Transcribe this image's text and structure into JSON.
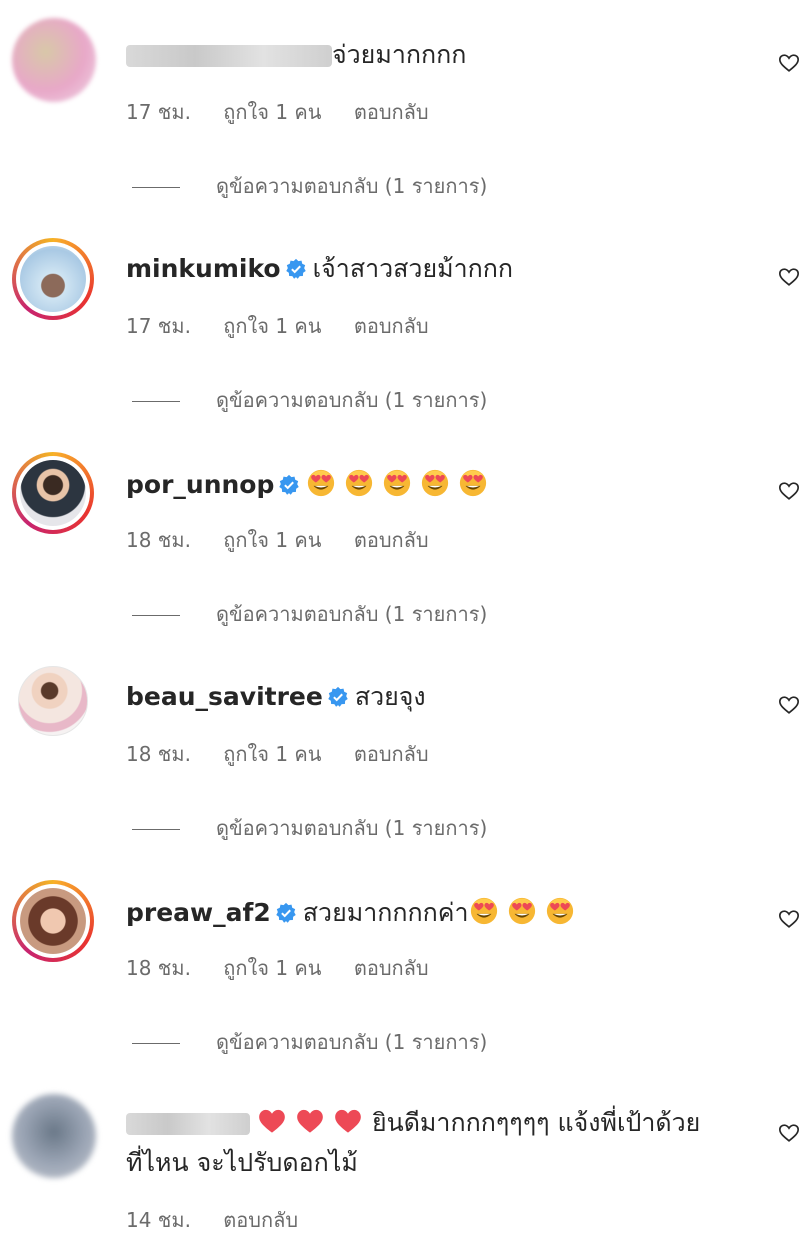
{
  "comments": [
    {
      "username": "",
      "blurred": true,
      "verified": false,
      "text": "จ่วยมากกกก",
      "time": "17 ชม.",
      "likes": "ถูกใจ 1 คน",
      "reply_label": "ตอบกลับ",
      "view_replies": "ดูข้อความตอบกลับ (1 รายการ)"
    },
    {
      "username": "minkumiko",
      "verified": true,
      "text": "เจ้าสาวสวยม้ากกก",
      "time": "17 ชม.",
      "likes": "ถูกใจ 1 คน",
      "reply_label": "ตอบกลับ",
      "view_replies": "ดูข้อความตอบกลับ (1 รายการ)"
    },
    {
      "username": "por_unnop",
      "verified": true,
      "text": "",
      "emoji_count": 5,
      "emoji_name": "heart-eyes-emoji",
      "time": "18 ชม.",
      "likes": "ถูกใจ 1 คน",
      "reply_label": "ตอบกลับ",
      "view_replies": "ดูข้อความตอบกลับ (1 รายการ)"
    },
    {
      "username": "beau_savitree",
      "verified": true,
      "text": "สวยจุง",
      "time": "18 ชม.",
      "likes": "ถูกใจ 1 คน",
      "reply_label": "ตอบกลับ",
      "view_replies": "ดูข้อความตอบกลับ (1 รายการ)"
    },
    {
      "username": "preaw_af2",
      "verified": true,
      "text": "สวยมากกกกค่า",
      "emoji_count": 3,
      "emoji_name": "heart-eyes-emoji",
      "time": "18 ชม.",
      "likes": "ถูกใจ 1 คน",
      "reply_label": "ตอบกลับ",
      "view_replies": "ดูข้อความตอบกลับ (1 รายการ)"
    },
    {
      "username": "",
      "blurred": true,
      "verified": false,
      "heart_count": 3,
      "text_line1": "ยินดีมากกกๆๆๆๆ แจ้งพี่เป้าด้วย",
      "text_line2": "ที่ไหน จะไปรับดอกไม้",
      "time": "14 ชม.",
      "reply_label": "ตอบกลับ"
    }
  ],
  "colors": {
    "meta_text": "#6b6b6b",
    "verified_blue": "#3897f0",
    "heart_red": "#ed4956"
  },
  "icons": {
    "like": "heart-outline-icon",
    "verified": "verified-badge-icon"
  }
}
